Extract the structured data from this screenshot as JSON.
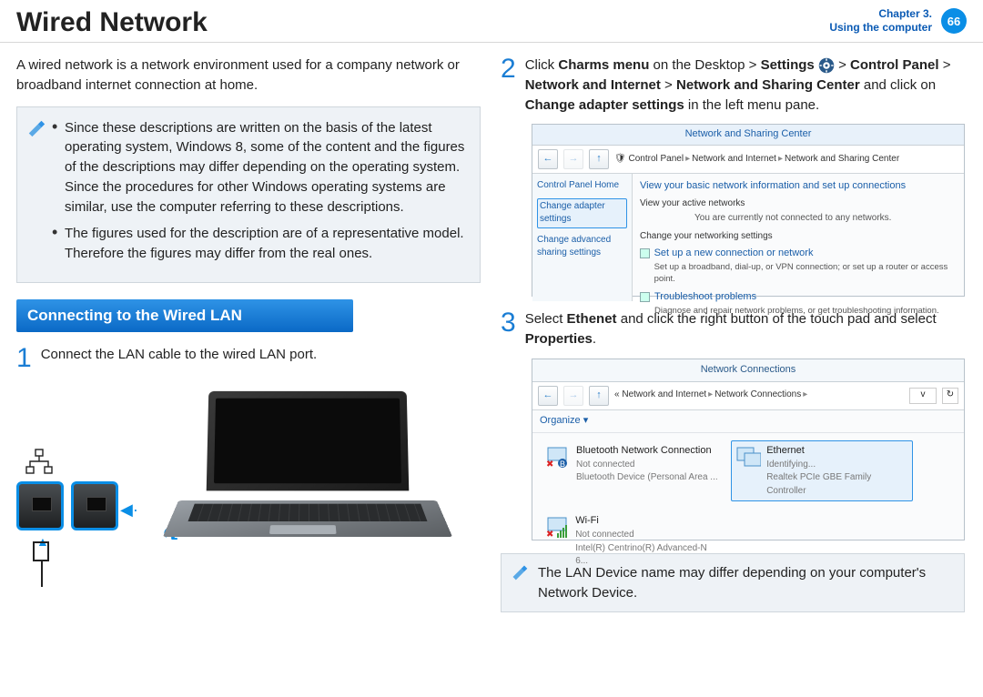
{
  "header": {
    "title": "Wired Network",
    "chapter_line1": "Chapter 3.",
    "chapter_line2": "Using the computer",
    "page_number": "66"
  },
  "left": {
    "intro": "A wired network is a network environment used for a company network or broadband internet connection at home.",
    "note_bullets": [
      "Since these descriptions are written on the basis of the latest operating system, Windows 8, some of the content and the figures of the descriptions may differ depending on the operating system. Since the procedures for other Windows operating systems are similar, use the computer referring to these descriptions.",
      "The figures used for the description are of a representative model. Therefore the figures may differ from the real ones."
    ],
    "section_heading": "Connecting to the Wired LAN",
    "step1_num": "1",
    "step1_text": "Connect the LAN cable to the wired LAN port."
  },
  "right": {
    "step2_num": "2",
    "step2": {
      "p1a": "Click ",
      "p1b": "Charms menu",
      "p1c": " on the Desktop > ",
      "p1d": "Settings",
      "p1e": " > ",
      "p2a": "Control Panel",
      "p2b": " > ",
      "p2c": "Network and Internet",
      "p2d": " > ",
      "p2e": "Network and Sharing Center",
      "p2f": " and click on ",
      "p2g": "Change adapter settings",
      "p2h": " in the left menu pane."
    },
    "fig_ns": {
      "title": "Network and Sharing Center",
      "crumb1": "Control Panel",
      "crumb2": "Network and Internet",
      "crumb3": "Network and Sharing Center",
      "side_home": "Control Panel Home",
      "side_change_adapter": "Change adapter settings",
      "side_change_adv": "Change advanced sharing settings",
      "main_heading": "View your basic network information and set up connections",
      "view_active": "View your active networks",
      "not_connected": "You are currently not connected to any networks.",
      "change_settings": "Change your networking settings",
      "setup_new": "Set up a new connection or network",
      "setup_sub": "Set up a broadband, dial-up, or VPN connection; or set up a router or access point.",
      "troubleshoot": "Troubleshoot problems",
      "troubleshoot_sub": "Diagnose and repair network problems, or get troubleshooting information."
    },
    "step3_num": "3",
    "step3": {
      "a": "Select ",
      "b": "Ethenet",
      "c": " and click the right button of the touch pad and select ",
      "d": "Properties",
      "e": "."
    },
    "fig_nc": {
      "title": "Network Connections",
      "crumb_prefix": "«",
      "crumb1": "Network and Internet",
      "crumb2": "Network Connections",
      "organize": "Organize ▾",
      "items": [
        {
          "name": "Bluetooth Network Connection",
          "stat": "Not connected",
          "dev": "Bluetooth Device (Personal Area ..."
        },
        {
          "name": "Ethernet",
          "stat": "Identifying...",
          "dev": "Realtek PCIe GBE Family Controller"
        },
        {
          "name": "Wi-Fi",
          "stat": "Not connected",
          "dev": "Intel(R) Centrino(R) Advanced-N 6..."
        }
      ]
    },
    "tip": "The LAN Device name may differ depending on your computer's Network Device."
  }
}
